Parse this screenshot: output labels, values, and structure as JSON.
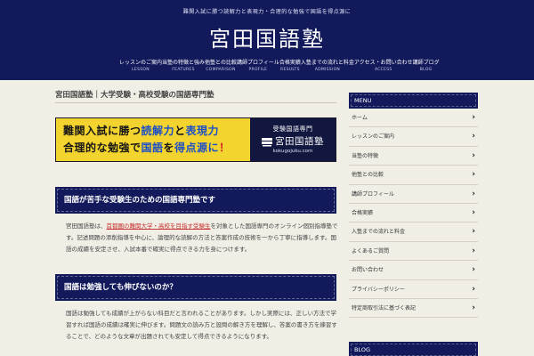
{
  "header": {
    "tagline": "難関入試に勝つ読解力と表現力・合理的な勉強で国語を得点源に",
    "title": "宮田国語塾",
    "nav": [
      {
        "jp": "レッスンのご案内",
        "en": "LESSON"
      },
      {
        "jp": "当塾の特徴と強み",
        "en": "FEATURES"
      },
      {
        "jp": "他塾との比較",
        "en": "COMPARISON"
      },
      {
        "jp": "講師プロフィール",
        "en": "PROFILE"
      },
      {
        "jp": "合格実績",
        "en": "RESULTS"
      },
      {
        "jp": "入塾までの流れと料金",
        "en": "ADMISSION"
      },
      {
        "jp": "アクセス・お問い合わせ",
        "en": "ACCESS"
      },
      {
        "jp": "講師ブログ",
        "en": "BLOG"
      }
    ]
  },
  "main": {
    "page_title": "宮田国語塾｜大学受験・高校受験の国語専門塾",
    "banner": {
      "line1_a": "難関入試に勝つ",
      "line1_b": "読解力",
      "line1_c": "と",
      "line1_d": "表現力",
      "line2_a": "合理的な勉強で",
      "line2_b": "国語",
      "line2_c": "を",
      "line2_d": "得点源に",
      "line2_e": "！",
      "logo_sub": "受験国語専門",
      "logo_name": "宮田国語塾",
      "logo_url": "kokugojuku.com"
    },
    "section1": {
      "heading": "国語が苦手な受験生のための国語専門塾です",
      "link_text": "首都圏の難関大学・高校を目指す受験生",
      "para_lead": "宮田国語塾は、",
      "para_rest": "を対象とした国語専門のオンライン個別指導塾です。記述問題の添削指導を中心に、論理的な読解の方法と答案作成の技術を一から丁寧に指導します。国語の成績を安定させ、入試本番で確実に得点できる力を身につけます。"
    },
    "section2": {
      "heading": "国語は勉強しても伸びないのか？",
      "para": "国語は勉強しても成績が上がらない科目だと言われることがあります。しかし実際には、正しい方法で学習すれば国語の成績は確実に伸びます。問題文の読み方と設問の解き方を理解し、答案の書き方を練習することで、どのような文章が出題されても安定して得点できるようになります。"
    }
  },
  "sidebar": {
    "menu_title": "MENU",
    "items": [
      "ホーム",
      "レッスンのご案内",
      "当塾の特徴",
      "他塾との比較",
      "講師プロフィール",
      "合格実績",
      "入塾までの流れと料金",
      "よくあるご質問",
      "お問い合わせ",
      "プライバシーポリシー",
      "特定商取引法に基づく表記"
    ],
    "blog_title": "BLOG"
  },
  "colors": {
    "navy": "#131a5c",
    "background": "#f1eee6",
    "banner_yellow": "#f3d32d",
    "link_red": "#c6322d"
  }
}
